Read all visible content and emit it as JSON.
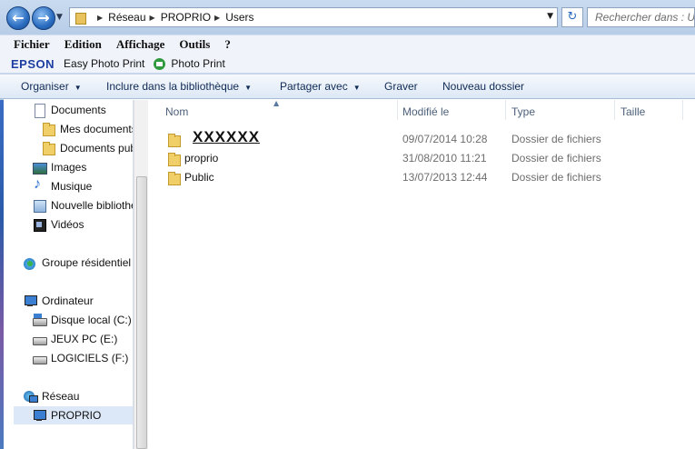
{
  "address": {
    "crumbs": [
      "Réseau",
      "PROPRIO",
      "Users"
    ],
    "search_placeholder": "Rechercher dans : Users"
  },
  "menu": [
    "Fichier",
    "Edition",
    "Affichage",
    "Outils",
    "?"
  ],
  "epson": {
    "logo": "EPSON",
    "easy_photo_print": "Easy Photo Print",
    "photo_print": "Photo Print"
  },
  "toolbar": {
    "organize": "Organiser",
    "include_library": "Inclure dans la bibliothèque",
    "share": "Partager avec",
    "burn": "Graver",
    "new_folder": "Nouveau dossier"
  },
  "sidebar": {
    "items": [
      {
        "label": "Documents",
        "icon": "documents-library-icon"
      },
      {
        "label": "Mes documents",
        "icon": "folder-icon"
      },
      {
        "label": "Documents publics",
        "icon": "folder-icon"
      },
      {
        "label": "Images",
        "icon": "images-library-icon"
      },
      {
        "label": "Musique",
        "icon": "music-library-icon"
      },
      {
        "label": "Nouvelle bibliothèque",
        "icon": "library-icon"
      },
      {
        "label": "Vidéos",
        "icon": "videos-library-icon"
      },
      {
        "label": "Groupe résidentiel",
        "icon": "homegroup-icon"
      },
      {
        "label": "Ordinateur",
        "icon": "computer-icon"
      },
      {
        "label": "Disque local (C:)",
        "icon": "local-disk-icon"
      },
      {
        "label": "JEUX PC (E:)",
        "icon": "drive-icon"
      },
      {
        "label": "LOGICIELS (F:)",
        "icon": "drive-icon"
      },
      {
        "label": "Réseau",
        "icon": "network-icon"
      },
      {
        "label": "PROPRIO",
        "icon": "network-computer-icon"
      }
    ]
  },
  "columns": {
    "name": "Nom",
    "modified": "Modifié le",
    "type": "Type",
    "size": "Taille"
  },
  "files": [
    {
      "name": "XXXXXX",
      "modified": "09/07/2014 10:28",
      "type": "Dossier de fichiers"
    },
    {
      "name": "proprio",
      "modified": "31/08/2010 11:21",
      "type": "Dossier de fichiers"
    },
    {
      "name": "Public",
      "modified": "13/07/2013 12:44",
      "type": "Dossier de fichiers"
    }
  ]
}
